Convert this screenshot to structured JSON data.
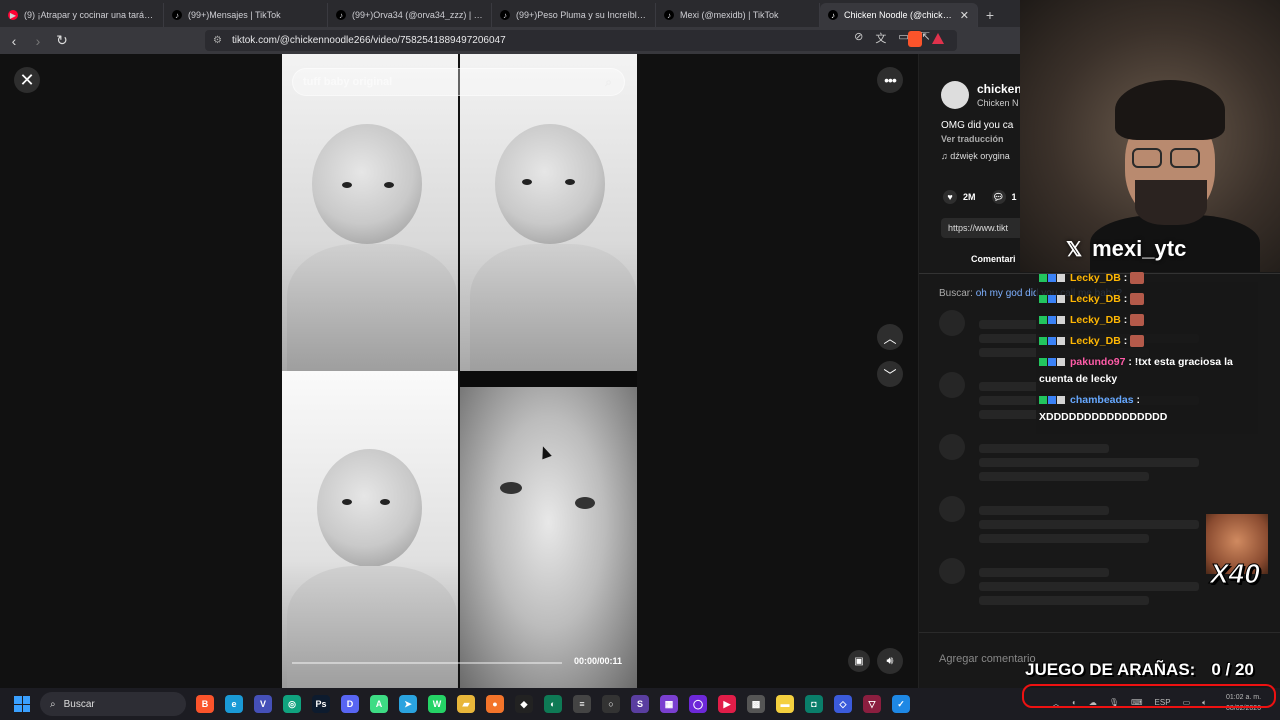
{
  "browser": {
    "tabs": [
      {
        "title": "(9) ¡Atrapar y cocinar una tarántula! ...",
        "icon": "youtube-icon",
        "active": false
      },
      {
        "title": "(99+)Mensajes | TikTok",
        "icon": "tiktok-icon",
        "active": false
      },
      {
        "title": "(99+)Orva34 (@orva34_zzz) | TikTok",
        "icon": "tiktok-icon",
        "active": false
      },
      {
        "title": "(99+)Peso Pluma y su Increíble Impa...",
        "icon": "tiktok-icon",
        "active": false
      },
      {
        "title": "Mexi (@mexidb) | TikTok",
        "icon": "tiktok-icon",
        "active": false
      },
      {
        "title": "Chicken Noodle (@chickenno...",
        "icon": "tiktok-icon",
        "active": true
      }
    ],
    "url": "tiktok.com/@chickennoodle266/video/7582541889497206047"
  },
  "video": {
    "search_placeholder": "tuff baby original",
    "timecode": "00:00/00:11",
    "progress": 0
  },
  "sidebar": {
    "username": "chicken",
    "display_name": "Chicken N",
    "description": "OMG did you ca",
    "translate": "Ver traducción",
    "music": "♫ dźwięk orygina",
    "likes": "2M",
    "comments": "1",
    "link": "https://www.tikt",
    "comments_tab": "Comentari",
    "search_prefix": "Buscar:",
    "search_query": "oh my god did you call me baby?",
    "add_comment_placeholder": "Agregar comentario"
  },
  "stream": {
    "cam_tag": "mexi_ytc",
    "chat": [
      {
        "user": "Lecky_DB",
        "text": "",
        "user_class": "u-lecky",
        "emote": true
      },
      {
        "user": "Lecky_DB",
        "text": "",
        "user_class": "u-lecky",
        "emote": true
      },
      {
        "user": "Lecky_DB",
        "text": "",
        "user_class": "u-lecky",
        "emote": true
      },
      {
        "user": "Lecky_DB",
        "text": "",
        "user_class": "u-lecky",
        "emote": true
      },
      {
        "user": "pakundo97",
        "text": "!txt esta graciosa la cuenta de lecky",
        "user_class": "u-pak",
        "emote": false
      },
      {
        "user": "chambeadas",
        "text": "XDDDDDDDDDDDDDDDD",
        "user_class": "u-cha",
        "emote": false
      }
    ],
    "multiplier": "X40",
    "game_label": "JUEGO DE ARAÑAS:",
    "game_score": "0 / 20"
  },
  "taskbar": {
    "search_label": "Buscar",
    "apps": [
      {
        "name": "brave-icon",
        "color": "#fb542b",
        "glyph": "B"
      },
      {
        "name": "edge-icon",
        "color": "#1a9ad6",
        "glyph": "e"
      },
      {
        "name": "vivaldi-icon",
        "color": "#4550b8",
        "glyph": "V"
      },
      {
        "name": "app-icon",
        "color": "#10a37f",
        "glyph": "◎"
      },
      {
        "name": "photoshop-icon",
        "color": "#0d1b2e",
        "glyph": "Ps"
      },
      {
        "name": "discord-icon",
        "color": "#5865f2",
        "glyph": "D"
      },
      {
        "name": "android-icon",
        "color": "#3ddc84",
        "glyph": "A"
      },
      {
        "name": "telegram-icon",
        "color": "#2aa3df",
        "glyph": "➤"
      },
      {
        "name": "whatsapp-icon",
        "color": "#25d366",
        "glyph": "W"
      },
      {
        "name": "folder-icon",
        "color": "#e8b63a",
        "glyph": "▰"
      },
      {
        "name": "app-icon",
        "color": "#f3742a",
        "glyph": "●"
      },
      {
        "name": "app-icon",
        "color": "#222",
        "glyph": "◆"
      },
      {
        "name": "app-icon",
        "color": "#0e7a55",
        "glyph": "◐"
      },
      {
        "name": "app-icon",
        "color": "#444",
        "glyph": "≡"
      },
      {
        "name": "obs-icon",
        "color": "#333",
        "glyph": "○"
      },
      {
        "name": "app-icon",
        "color": "#5a3ea0",
        "glyph": "S"
      },
      {
        "name": "app-icon",
        "color": "#7a3fd0",
        "glyph": "▦"
      },
      {
        "name": "app-icon",
        "color": "#6d28d9",
        "glyph": "◯"
      },
      {
        "name": "app-icon",
        "color": "#e11d48",
        "glyph": "▶"
      },
      {
        "name": "app-icon",
        "color": "#555",
        "glyph": "▩"
      },
      {
        "name": "notes-icon",
        "color": "#f4d03f",
        "glyph": "▬"
      },
      {
        "name": "app-icon",
        "color": "#0a7e6a",
        "glyph": "◘"
      },
      {
        "name": "app-icon",
        "color": "#3b5bdb",
        "glyph": "◇"
      },
      {
        "name": "app-icon",
        "color": "#8b1e3f",
        "glyph": "▽"
      },
      {
        "name": "app-icon",
        "color": "#1e88e5",
        "glyph": "✓"
      }
    ],
    "tray_lang": "ESP",
    "time": "01:02 a. m.",
    "date": "08/02/2026"
  }
}
